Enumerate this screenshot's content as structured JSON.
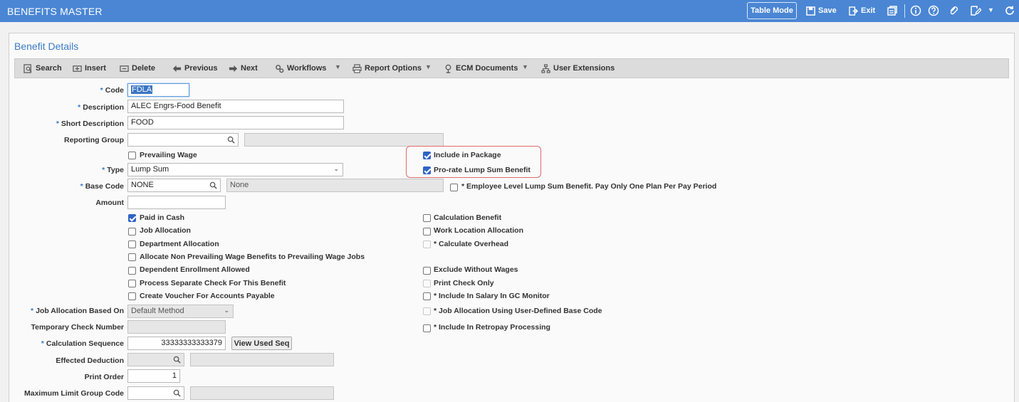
{
  "app": {
    "title": "BENEFITS MASTER",
    "table_mode_label": "Table Mode",
    "save_label": "Save",
    "exit_label": "Exit"
  },
  "panel": {
    "title": "Benefit Details"
  },
  "toolbar": {
    "search": "Search",
    "insert": "Insert",
    "delete": "Delete",
    "previous": "Previous",
    "next": "Next",
    "workflows": "Workflows",
    "report_options": "Report Options",
    "ecm_documents": "ECM Documents",
    "user_extensions": "User Extensions"
  },
  "form": {
    "required_mark": "*",
    "code": {
      "label": "Code",
      "value": "FDLA"
    },
    "description": {
      "label": "Description",
      "value": "ALEC Engrs-Food Benefit"
    },
    "short_description": {
      "label": "Short Description",
      "value": "FOOD"
    },
    "reporting_group": {
      "label": "Reporting Group",
      "value": "",
      "desc": ""
    },
    "prevailing_wage": {
      "label": "Prevailing Wage",
      "checked": false
    },
    "include_in_package": {
      "label": "Include in Package",
      "checked": true
    },
    "prorate_lump_sum": {
      "label": "Pro-rate Lump Sum Benefit",
      "checked": true
    },
    "type": {
      "label": "Type",
      "value": "Lump Sum"
    },
    "base_code": {
      "label": "Base Code",
      "value": "NONE",
      "desc": "None"
    },
    "employee_level_lump_sum": {
      "label": "* Employee Level Lump Sum Benefit. Pay Only One Plan Per Pay Period",
      "checked": false
    },
    "amount": {
      "label": "Amount",
      "value": ""
    },
    "paid_in_cash": {
      "label": "Paid in Cash",
      "checked": true
    },
    "job_allocation": {
      "label": "Job Allocation",
      "checked": false
    },
    "department_allocation": {
      "label": "Department Allocation",
      "checked": false
    },
    "allocate_non_prevailing": {
      "label": "Allocate Non Prevailing Wage Benefits to Prevailing Wage Jobs",
      "checked": false
    },
    "dependent_enrollment": {
      "label": "Dependent Enrollment Allowed",
      "checked": false
    },
    "process_separate_check": {
      "label": "Process Separate Check For This Benefit",
      "checked": false
    },
    "create_voucher": {
      "label": "Create Voucher For Accounts Payable",
      "checked": false
    },
    "calculation_benefit": {
      "label": "Calculation Benefit",
      "checked": false
    },
    "work_location_allocation": {
      "label": "Work Location Allocation",
      "checked": false
    },
    "calculate_overhead": {
      "label": "* Calculate Overhead",
      "checked": false
    },
    "exclude_without_wages": {
      "label": "Exclude Without Wages",
      "checked": false
    },
    "print_check_only": {
      "label": "Print Check Only",
      "checked": false
    },
    "include_in_salary_gc": {
      "label": "* Include In Salary In GC Monitor",
      "checked": false
    },
    "job_alloc_user_defined": {
      "label": "* Job Allocation Using User-Defined Base Code",
      "checked": false
    },
    "include_in_retropay": {
      "label": "* Include In Retropay Processing",
      "checked": false
    },
    "job_allocation_based_on": {
      "label": "Job Allocation Based On",
      "value": "Default Method"
    },
    "temporary_check_number": {
      "label": "Temporary Check Number",
      "value": ""
    },
    "calculation_sequence": {
      "label": "Calculation Sequence",
      "value": "33333333333379",
      "button": "View Used Seq"
    },
    "effected_deduction": {
      "label": "Effected Deduction",
      "value": "",
      "desc": ""
    },
    "print_order": {
      "label": "Print Order",
      "value": "1"
    },
    "max_limit_group_code": {
      "label": "Maximum Limit Group Code",
      "value": "",
      "desc": ""
    }
  },
  "colors": {
    "titlebar": "#4a86d4",
    "accent": "#3b7bc7",
    "highlight_border": "#e06b6b",
    "checkbox_checked": "#2f64c4"
  }
}
